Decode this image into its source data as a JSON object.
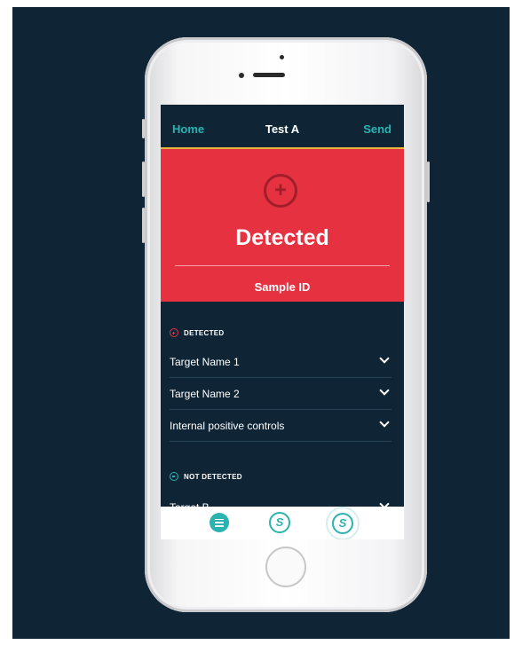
{
  "nav": {
    "home": "Home",
    "title": "Test A",
    "send": "Send"
  },
  "result": {
    "icon": "plus-circle-icon",
    "status": "Detected",
    "sample_label": "Sample ID"
  },
  "detected": {
    "header": "DETECTED",
    "icon": "plus-circle-icon",
    "items": [
      {
        "label": "Target Name 1"
      },
      {
        "label": "Target Name 2"
      },
      {
        "label": "Internal positive controls"
      }
    ]
  },
  "not_detected": {
    "header": "NOT DETECTED",
    "icon": "minus-circle-icon",
    "items": [
      {
        "label": "Target B"
      }
    ]
  },
  "tabbar": {
    "items": [
      {
        "icon": "list-icon"
      },
      {
        "icon": "s-logo-icon"
      },
      {
        "icon": "s-logo-active-icon"
      }
    ]
  },
  "colors": {
    "background": "#0f2536",
    "accent": "#2ab3b1",
    "detected": "#e53140",
    "nav_underline": "#e7b73d"
  }
}
